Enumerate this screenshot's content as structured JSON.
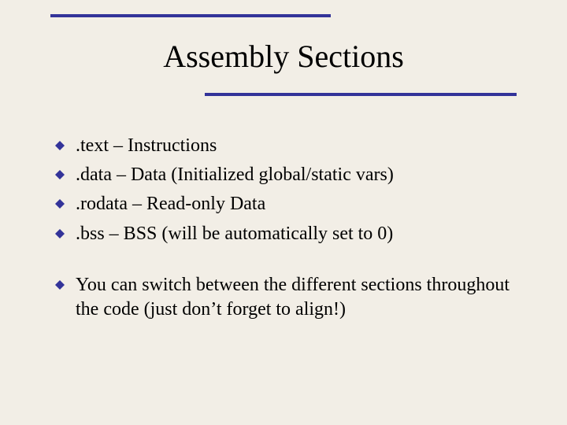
{
  "title": "Assembly Sections",
  "bullets_group1": [
    ".text – Instructions",
    ".data – Data (Initialized global/static vars)",
    ".rodata – Read-only Data",
    ".bss – BSS (will be automatically set to 0)"
  ],
  "bullets_group2": [
    "You can switch between the different sections throughout the code (just don’t forget to align!)"
  ],
  "colors": {
    "accent": "#333399",
    "background": "#f2eee6"
  }
}
